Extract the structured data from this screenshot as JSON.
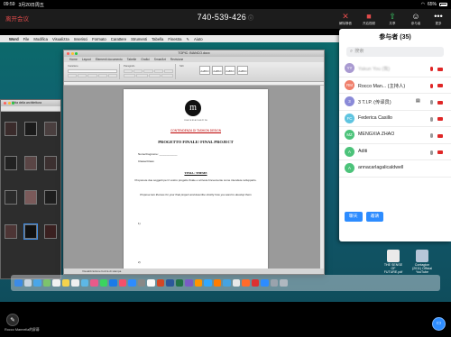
{
  "status_bar": {
    "time": "09:59",
    "date": "3月20日周五",
    "battery": "65%"
  },
  "zoom_top": {
    "leave_label": "离开会议",
    "meeting_id": "740-539-426",
    "lock_icon": "ⓘ",
    "buttons": [
      {
        "name": "mute-button",
        "icon": "mic-off-icon",
        "glyph": "🎤",
        "color": "#e14b4b",
        "label": "解除静音"
      },
      {
        "name": "start-video-button",
        "icon": "camera-off-icon",
        "glyph": "▬",
        "color": "#e14b4b",
        "label": "开启视频"
      },
      {
        "name": "share-button",
        "icon": "share-up-icon",
        "glyph": "⇧",
        "color": "#3ecf6a",
        "label": "共享"
      },
      {
        "name": "participants-button",
        "icon": "person-icon",
        "glyph": "👤",
        "color": "#ffffff",
        "label": "参与者"
      },
      {
        "name": "more-button",
        "icon": "more-dots-icon",
        "glyph": "•••",
        "color": "#ffffff",
        "label": "更多"
      }
    ]
  },
  "mac_menubar": {
    "apple": "",
    "items": [
      "Word",
      "File",
      "Modifica",
      "Visualizza",
      "Inserisci",
      "Formato",
      "Carattere",
      "Strumenti",
      "Tabella",
      "Finestra",
      "",
      "Aiuto"
    ]
  },
  "word": {
    "title": "TOPIC: BIANCO.docx",
    "tabs": [
      "Home",
      "Layout",
      "Elementi documento",
      "Tabelle",
      "Grafici",
      "SmartArt",
      "Revisione"
    ],
    "status": "Visualizzazione bozza di stampa",
    "ribbon_groups": [
      "Carattere",
      "Paragrafo",
      "Stili",
      "Inserisci"
    ],
    "styles": [
      "AaBbC",
      "AaBbC",
      "AaBbC",
      "AaBbC"
    ],
    "doc": {
      "logo": "m",
      "brand": "n a o s m a n a s t i t e",
      "red1": "CONTENDENZA DI TASHION DESIGN",
      "title": "PROGETTO FINALE/ FINAL PROJECT",
      "line1": "Nome/Cognome: ____________",
      "line2": "Classe/Class:",
      "tema": "TEMA / THEME",
      "p1": "Proponete due soggetti per il vostro progetto finale e scrivete brevemente come intendete svilupparlo.",
      "p2": "Propose two themes for your final project and describe shortly how you want to develop them",
      "n1": "1)",
      "n2": "2)"
    }
  },
  "finder": {
    "title": "Citta della architettura"
  },
  "desktop_files": [
    {
      "label": "THE SENSE OF FUTURE.pdf"
    },
    {
      "label": "Contagion (2011) Official YouTube"
    }
  ],
  "participants": {
    "title": "参与者 (35)",
    "search_placeholder": "搜索",
    "list": [
      {
        "initials": "YY",
        "color": "#a99ad1",
        "name": "Yakun You (我)",
        "mic": "red",
        "cam": "red",
        "blur": true
      },
      {
        "initials": "RM",
        "color": "#f07f6b",
        "name": "Rocco Man... (主持人)",
        "mic": "red",
        "cam": "red",
        "blur": false
      },
      {
        "initials": "3",
        "color": "#8a8ad8",
        "name": "3 T.I.P. (传译员)",
        "mic": "gray",
        "cam": "red",
        "flag": true,
        "blur": false
      },
      {
        "initials": "FC",
        "color": "#5fc4e0",
        "name": "Federica Casillo",
        "mic": "gray",
        "cam": "red",
        "blur": false
      },
      {
        "initials": "MZ",
        "color": "#4cc37a",
        "name": "MENGXIA ZHAO",
        "mic": "gray",
        "cam": "red",
        "blur": false
      },
      {
        "initials": "A",
        "color": "#4cc37a",
        "name": "Aditi",
        "mic": "gray",
        "cam": "red",
        "blur": false
      },
      {
        "initials": "A",
        "color": "#4cc37a",
        "name": "annacarlagalicaldwell",
        "mic": "gray",
        "cam": "red",
        "blur": false
      }
    ],
    "chat_label": "聊天",
    "invite_label": "邀请"
  },
  "bottom": {
    "sharer": "Rocco Mannella的屏幕",
    "annotate_icon": "pencil-icon",
    "chat_icon": "chat-bubble-icon"
  }
}
